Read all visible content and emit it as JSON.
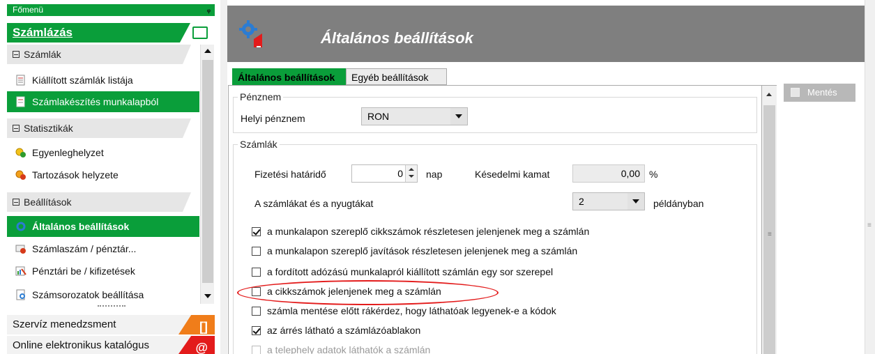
{
  "sidebar": {
    "header": "Főmenü",
    "pin": "ᵩ",
    "module": "Számlázás",
    "categories": [
      "Számlák",
      "Statisztikák",
      "Beállítások"
    ],
    "items": [
      {
        "label": "Kiállított számlák listája",
        "icon": "invoice-list-icon"
      },
      {
        "label": "Számlakészítés munkalapból",
        "icon": "worksheet-invoice-icon"
      },
      {
        "label": "Egyenleghelyzet",
        "icon": "balance-coins-icon"
      },
      {
        "label": "Tartozások helyzete",
        "icon": "debts-coins-icon"
      },
      {
        "label": "Általános beállítások",
        "icon": "general-settings-gear-icon"
      },
      {
        "label": "Számlaszám / pénztár...",
        "icon": "invoice-number-icon"
      },
      {
        "label": "Pénztári be / kifizetések",
        "icon": "cash-payments-icon"
      },
      {
        "label": "Számsorozatok beállítása",
        "icon": "number-series-icon"
      }
    ],
    "bottom_modules": [
      "Szervíz menedzsment",
      "Online elektronikus katalógus"
    ],
    "bottom_icons": [
      "[]",
      "@"
    ]
  },
  "main": {
    "title": "Általános beállítások",
    "tabs": [
      "Általános beállítások",
      "Egyéb beállítások"
    ],
    "save_label": "Mentés",
    "currency_group": {
      "legend": "Pénznem",
      "local_currency_label": "Helyi pénznem",
      "local_currency_value": "RON"
    },
    "invoice_group": {
      "legend": "Számlák",
      "due_label": "Fizetési határidő",
      "due_value": "0",
      "due_unit": "nap",
      "interest_label": "Késedelmi kamat",
      "interest_value": "0,00",
      "interest_unit": "%",
      "copies_label": "A számlákat és a nyugtákat",
      "copies_value": "2",
      "copies_unit": "példányban"
    },
    "options": [
      {
        "label": "a munkalapon szereplő cikkszámok részletesen jelenjenek meg a számlán",
        "checked": true,
        "disabled": false
      },
      {
        "label": "a munkalapon szereplő javítások részletesen jelenjenek meg a számlán",
        "checked": false,
        "disabled": false
      },
      {
        "label": "a fordított adózású munkalapról kiállított számlán egy sor szerepel",
        "checked": false,
        "disabled": false
      },
      {
        "label": "a cikkszámok jelenjenek meg a számlán",
        "checked": false,
        "disabled": false
      },
      {
        "label": "számla mentése előtt rákérdez, hogy láthatóak legyenek-e a kódok",
        "checked": false,
        "disabled": false
      },
      {
        "label": "az árrés látható a számlázóablakon",
        "checked": true,
        "disabled": false
      },
      {
        "label": "a telephely adatok láthatók a számlán",
        "checked": false,
        "disabled": true
      }
    ]
  },
  "colors": {
    "accent_green": "#0a9e3a",
    "header_gray": "#7f7f7f",
    "highlight_red": "#e31b1b",
    "service_orange": "#f07d1a",
    "catalog_red": "#e31b1b"
  }
}
